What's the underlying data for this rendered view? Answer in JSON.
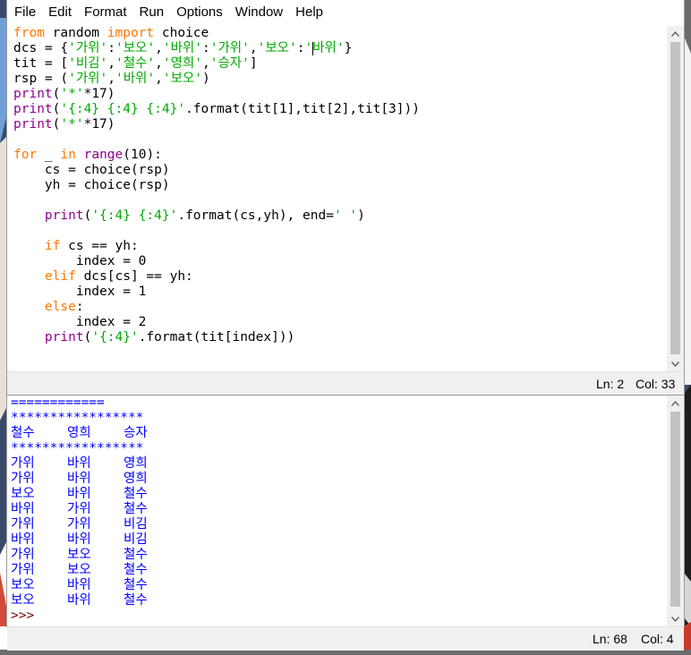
{
  "menu": {
    "file": "File",
    "edit": "Edit",
    "format": "Format",
    "run": "Run",
    "options": "Options",
    "window": "Window",
    "help": "Help"
  },
  "editor": {
    "status_line": "Ln: 2",
    "status_col": "Col: 33"
  },
  "shell": {
    "separator_top": "============",
    "stars_1": "*****************",
    "header": [
      "철수",
      "영희",
      "승자"
    ],
    "stars_2": "*****************",
    "rows": [
      [
        "가위",
        "바위",
        "영희"
      ],
      [
        "가위",
        "바위",
        "영희"
      ],
      [
        "보오",
        "바위",
        "철수"
      ],
      [
        "바위",
        "가위",
        "철수"
      ],
      [
        "가위",
        "가위",
        "비김"
      ],
      [
        "바위",
        "바위",
        "비김"
      ],
      [
        "가위",
        "보오",
        "철수"
      ],
      [
        "가위",
        "보오",
        "철수"
      ],
      [
        "보오",
        "바위",
        "철수"
      ],
      [
        "보오",
        "바위",
        "철수"
      ]
    ],
    "prompt": ">>>",
    "status_line": "Ln: 68",
    "status_col": "Col: 4"
  },
  "icons": {
    "scroll_up": "scroll-up-arrow-icon",
    "scroll_down": "scroll-down-arrow-icon"
  }
}
